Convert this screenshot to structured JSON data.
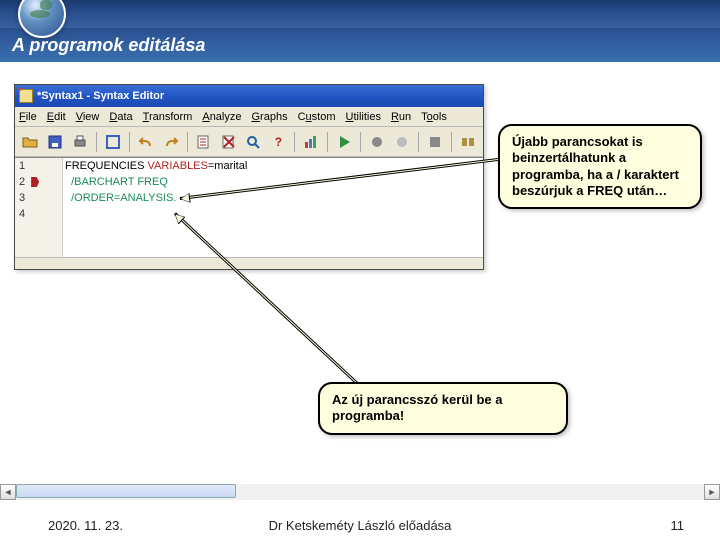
{
  "slide": {
    "title": "A programok  editálása"
  },
  "window": {
    "title": "*Syntax1 - Syntax Editor"
  },
  "menu": {
    "file": "File",
    "edit": "Edit",
    "view": "View",
    "data": "Data",
    "transform": "Transform",
    "analyze": "Analyze",
    "graphs": "Graphs",
    "custom": "Custom",
    "utilities": "Utilities",
    "run": "Run",
    "tools": "Tools"
  },
  "code": {
    "lines": [
      "1",
      "2",
      "3",
      "4"
    ],
    "l1_cmd": "FREQUENCIES",
    "l1_kw": "VARIABLES",
    "l1_eq": "=",
    "l1_var": "marital",
    "l2": "  /BARCHART FREQ",
    "l3": "  /ORDER=ANALYSIS."
  },
  "callouts": {
    "c1": "Újabb parancsokat is beinzertálhatunk a programba, ha a / karaktert beszúrjuk a FREQ után…",
    "c2": "Az új parancsszó kerül be a programba!"
  },
  "footer": {
    "date": "2020. 11. 23.",
    "author": "Dr Ketskeméty László előadása",
    "page": "11"
  },
  "icons": {
    "open": "open",
    "save": "save",
    "print": "print",
    "undo": "undo",
    "redo": "redo"
  }
}
